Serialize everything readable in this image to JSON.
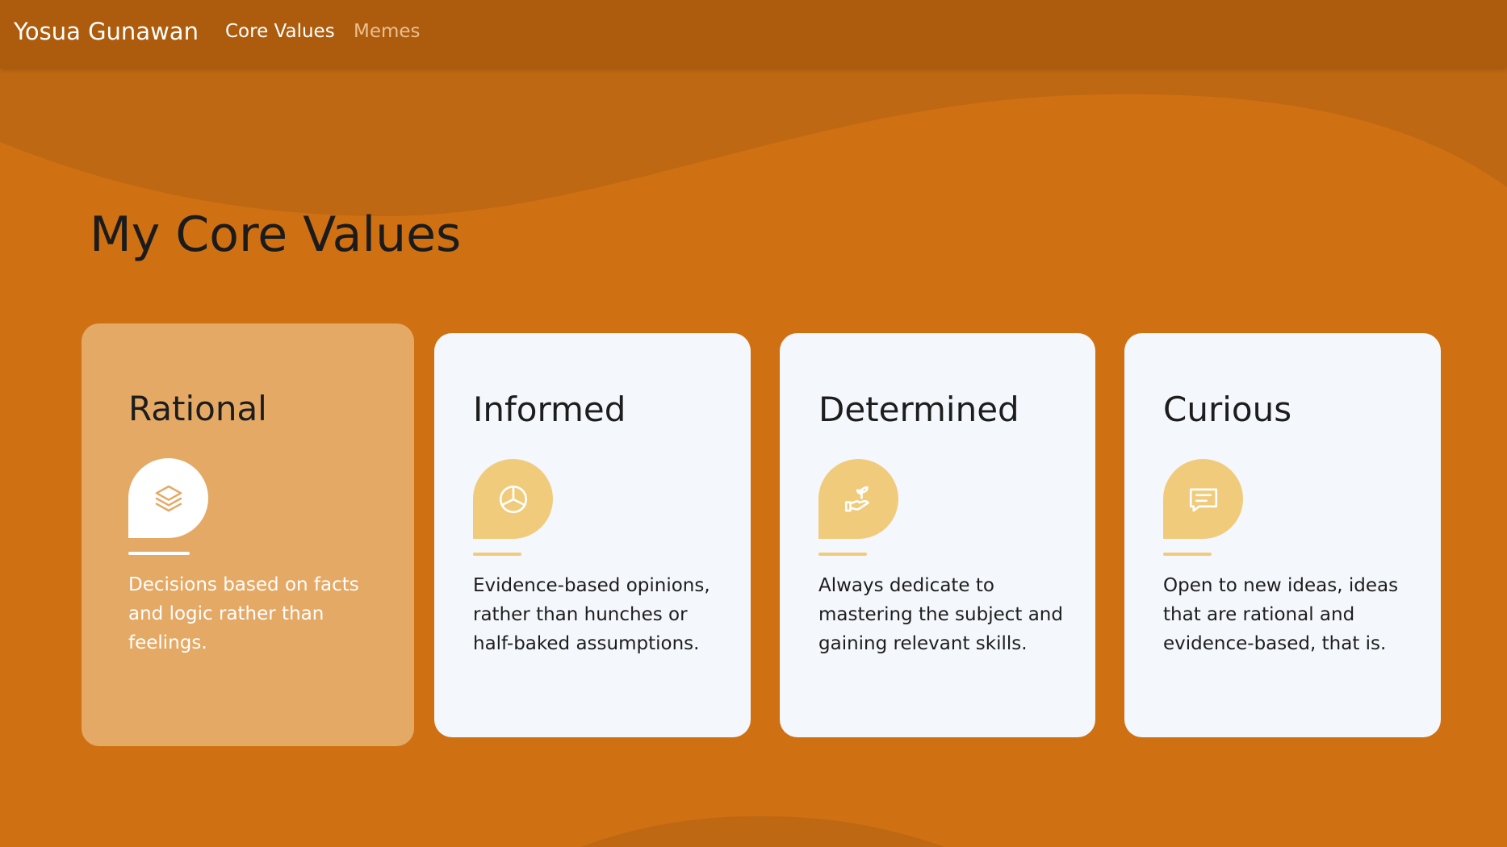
{
  "navbar": {
    "brand": "Yosua Gunawan",
    "links": [
      {
        "label": "Core Values",
        "active": true
      },
      {
        "label": "Memes",
        "active": false
      }
    ]
  },
  "main": {
    "title": "My Core Values",
    "cards": [
      {
        "title": "Rational",
        "icon": "layers-icon",
        "description": "Decisions based on facts and logic rather than feelings.",
        "highlighted": true
      },
      {
        "title": "Informed",
        "icon": "pie-chart-icon",
        "description": "Evidence-based opinions, rather than hunches or half-baked assumptions.",
        "highlighted": false
      },
      {
        "title": "Determined",
        "icon": "growth-hand-icon",
        "description": "Always dedicate to mastering the subject and gaining relevant skills.",
        "highlighted": false
      },
      {
        "title": "Curious",
        "icon": "message-icon",
        "description": "Open to new ideas, ideas that are rational and evidence-based, that is.",
        "highlighted": false
      }
    ]
  },
  "colors": {
    "background": "#cf7012",
    "navbar": "#ad5c0e",
    "card": "#f4f7fb",
    "card_highlight": "#e5a966",
    "icon_badge": "#f1cb7c",
    "nav_inactive": "#ebbf8e"
  }
}
